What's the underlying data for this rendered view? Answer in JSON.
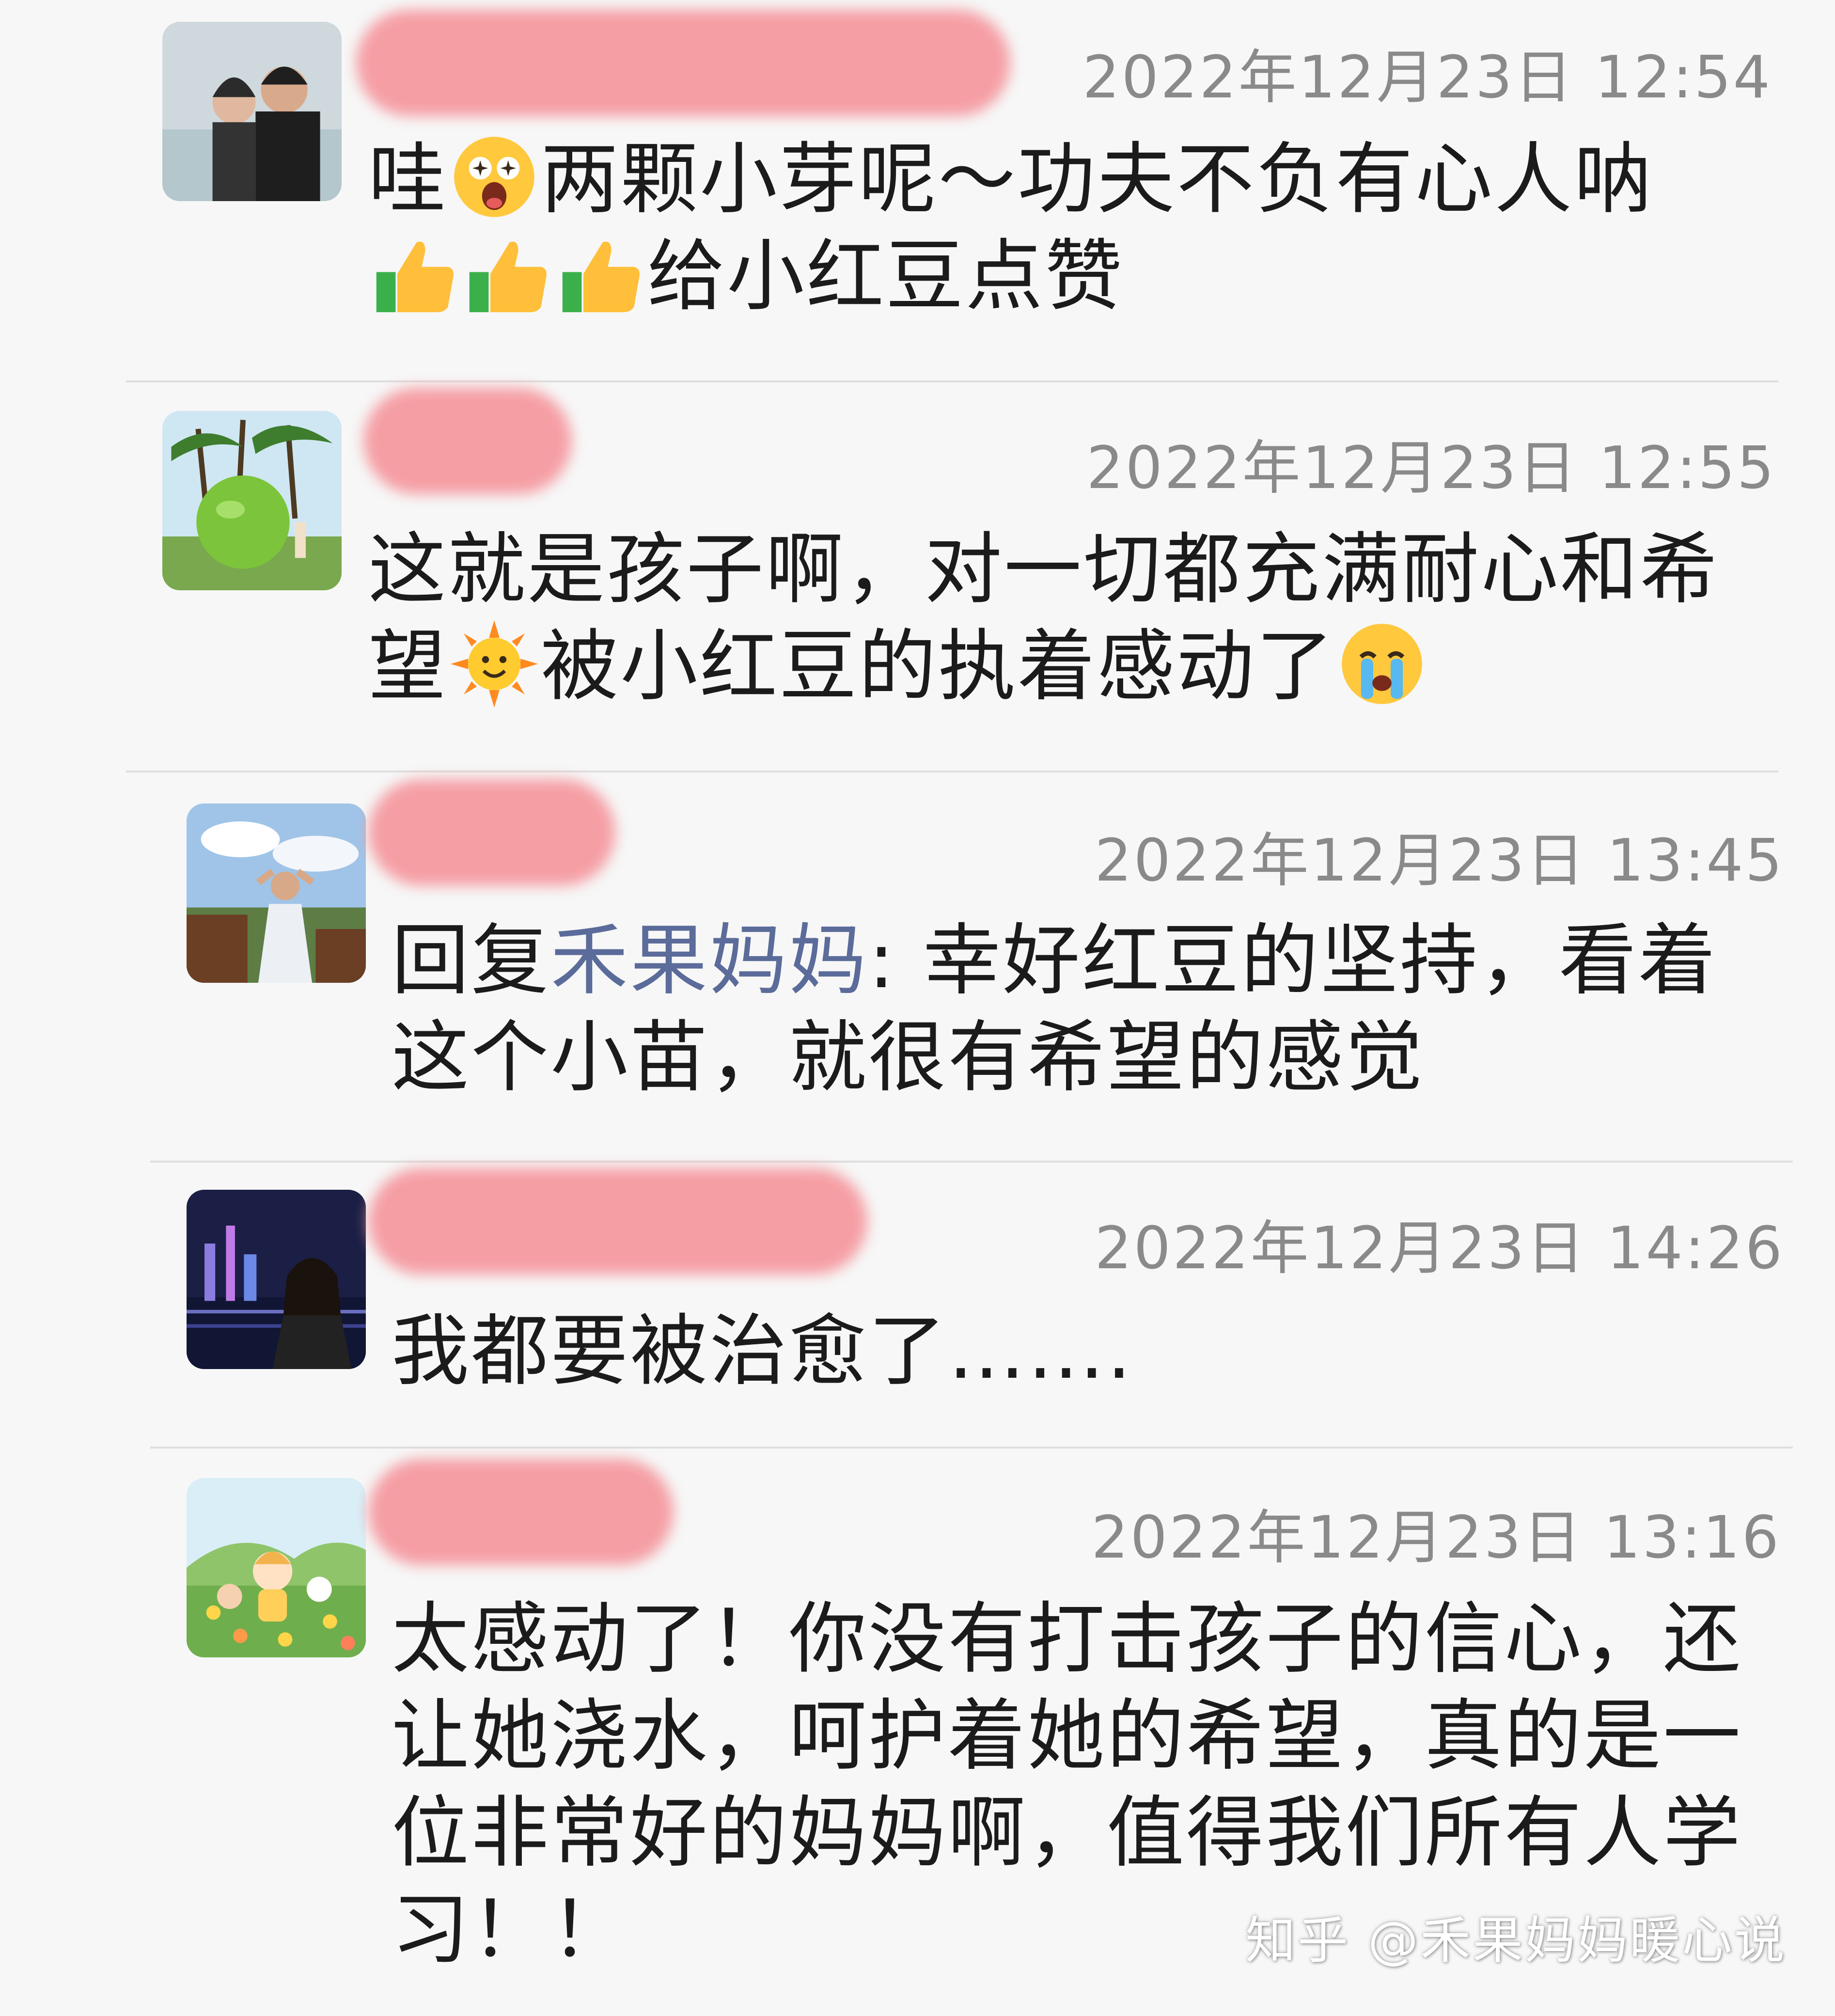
{
  "comments": [
    {
      "timestamp": "2022年12月23日 12:54",
      "text_parts": [
        "哇",
        "两颗小芽呢～功夫不负有心人呐",
        "给小红豆点赞"
      ]
    },
    {
      "timestamp": "2022年12月23日 12:55",
      "text_parts": [
        "这就是孩子啊，对一切都充满耐心和希望",
        "被小红豆的执着感动了"
      ]
    },
    {
      "timestamp": "2022年12月23日 13:45",
      "reply_prefix": "回复",
      "reply_to": "禾果妈妈",
      "text_parts": [
        ": 幸好红豆的坚持，看着这个小苗，就很有希望的感觉"
      ]
    },
    {
      "timestamp": "2022年12月23日 14:26",
      "text_parts": [
        "我都要被治愈了……."
      ]
    },
    {
      "timestamp": "2022年12月23日 13:16",
      "text_parts": [
        "太感动了！你没有打击孩子的信心，还让她浇水，呵护着她的希望，真的是一位非常好的妈妈啊，值得我们所有人学习！！"
      ]
    }
  ],
  "icons": {
    "emoji_1": "star-struck-face-icon",
    "emoji_2": "thumbs-up-icon",
    "emoji_3": "sun-face-icon",
    "emoji_4": "crying-face-icon"
  },
  "colors": {
    "name_redaction": "#f59aa0",
    "reply_name": "#5b6b9a",
    "timestamp": "#8a8a8a"
  },
  "watermark": "知乎 @禾果妈妈暖心说"
}
